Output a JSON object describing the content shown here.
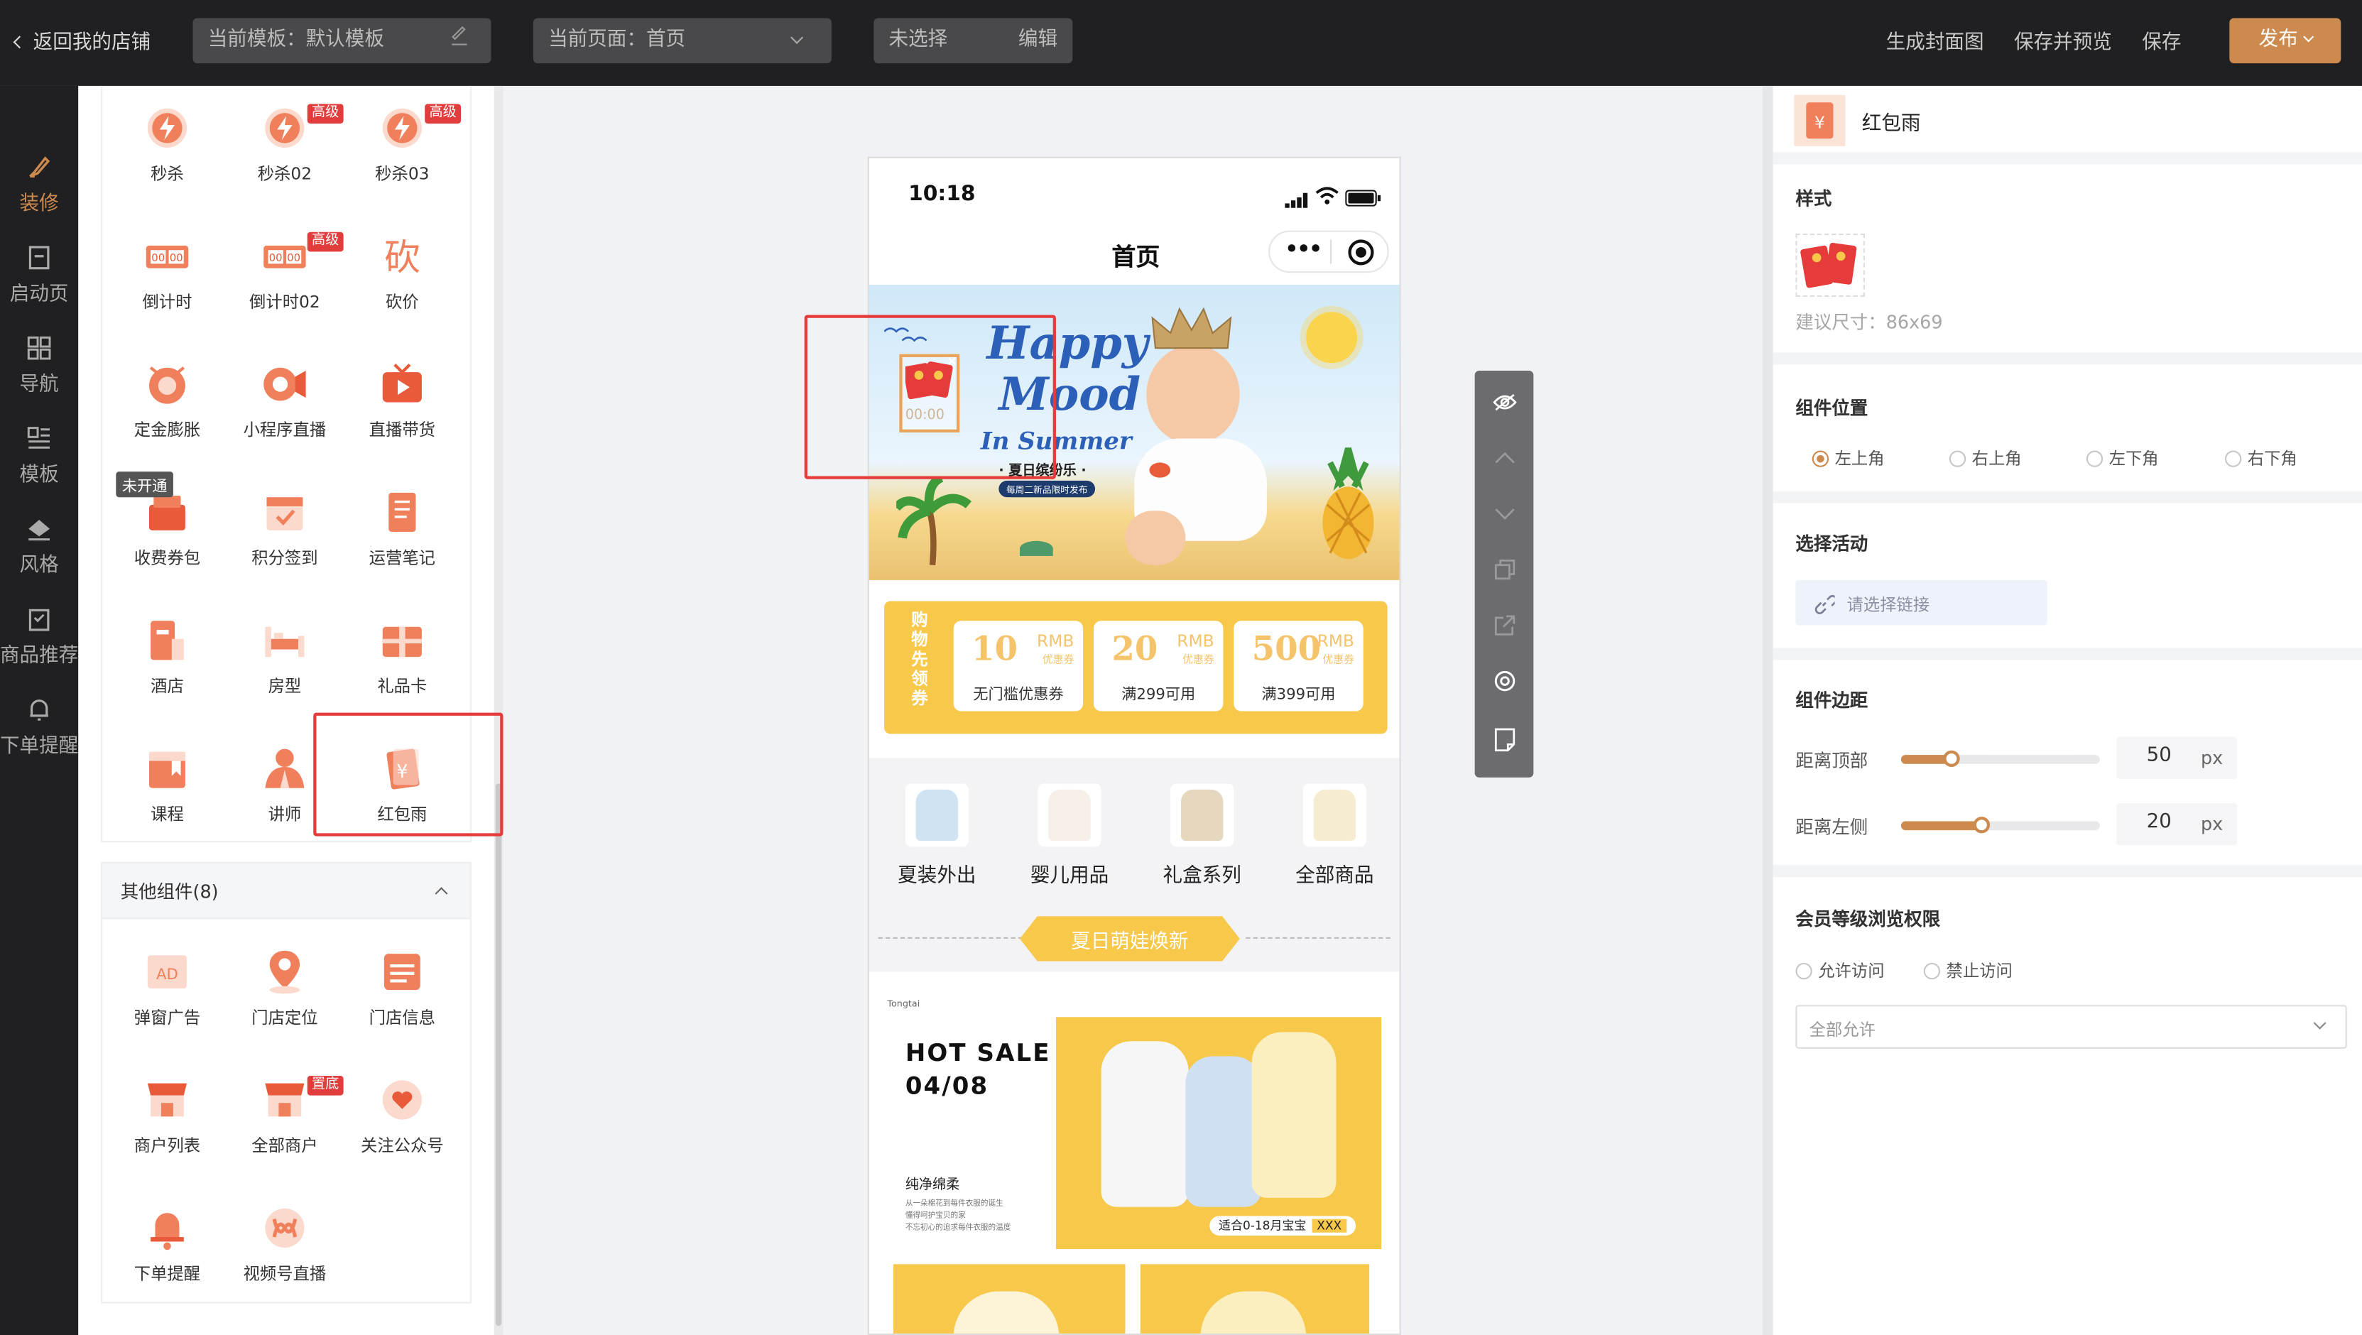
{
  "topbar": {
    "back_label": "返回我的店铺",
    "template_field": "当前模板：默认模板",
    "page_field": "当前页面：首页",
    "unselected_field": "未选择",
    "edit_label": "编辑",
    "generate_cover": "生成封面图",
    "save_preview": "保存并预览",
    "save": "保存",
    "publish": "发布"
  },
  "leftnav": {
    "items": [
      {
        "label": "装修",
        "icon": "brush-icon",
        "active": true
      },
      {
        "label": "启动页",
        "icon": "document-icon"
      },
      {
        "label": "导航",
        "icon": "grid-icon"
      },
      {
        "label": "模板",
        "icon": "template-icon"
      },
      {
        "label": "风格",
        "icon": "paint-bucket-icon"
      },
      {
        "label": "商品推荐",
        "icon": "product-icon"
      },
      {
        "label": "下单提醒",
        "icon": "bell-icon"
      }
    ]
  },
  "components": {
    "marketing": [
      {
        "label": "秒杀",
        "icon": "flash-sale-icon"
      },
      {
        "label": "秒杀02",
        "icon": "flash-sale-icon",
        "badge": "高级"
      },
      {
        "label": "秒杀03",
        "icon": "flash-sale-icon",
        "badge": "高级"
      },
      {
        "label": "倒计时",
        "icon": "countdown-icon"
      },
      {
        "label": "倒计时02",
        "icon": "countdown-icon",
        "badge": "高级"
      },
      {
        "label": "砍价",
        "icon": "bargain-icon"
      },
      {
        "label": "定金膨胀",
        "icon": "deposit-icon"
      },
      {
        "label": "小程序直播",
        "icon": "live-camera-icon"
      },
      {
        "label": "直播带货",
        "icon": "live-tv-icon"
      },
      {
        "label": "收费券包",
        "icon": "coupon-pack-icon",
        "tag": "未开通"
      },
      {
        "label": "积分签到",
        "icon": "calendar-check-icon"
      },
      {
        "label": "运营笔记",
        "icon": "notebook-icon"
      },
      {
        "label": "酒店",
        "icon": "hotel-icon"
      },
      {
        "label": "房型",
        "icon": "bed-icon"
      },
      {
        "label": "礼品卡",
        "icon": "gift-card-icon"
      },
      {
        "label": "课程",
        "icon": "course-icon"
      },
      {
        "label": "讲师",
        "icon": "lecturer-icon"
      },
      {
        "label": "红包雨",
        "icon": "red-envelope-icon"
      }
    ],
    "others_header": "其他组件(8)",
    "others": [
      {
        "label": "弹窗广告",
        "icon": "ad-icon"
      },
      {
        "label": "门店定位",
        "icon": "location-pin-icon"
      },
      {
        "label": "门店信息",
        "icon": "store-info-icon"
      },
      {
        "label": "商户列表",
        "icon": "shop-icon"
      },
      {
        "label": "全部商户",
        "icon": "shop-icon",
        "badge": "置底"
      },
      {
        "label": "关注公众号",
        "icon": "heart-icon"
      },
      {
        "label": "下单提醒",
        "icon": "bell-icon"
      },
      {
        "label": "视频号直播",
        "icon": "video-channel-icon"
      }
    ]
  },
  "phone": {
    "time": "10:18",
    "title": "首页",
    "banner": {
      "line1": "Happy",
      "line2": "Mood",
      "line3": "In Summer",
      "subtitle": "· 夏日缤纷乐 ·",
      "small": "每周二新品限时发布",
      "countdown": "00:00"
    },
    "coupon_label": "购物先领券",
    "coupons": [
      {
        "amount": "10",
        "unit": "RMB",
        "type": "优惠券",
        "desc": "无门槛优惠券"
      },
      {
        "amount": "20",
        "unit": "RMB",
        "type": "优惠券",
        "desc": "满299可用"
      },
      {
        "amount": "500",
        "unit": "RMB",
        "type": "优惠券",
        "desc": "满399可用"
      }
    ],
    "categories": [
      {
        "label": "夏装外出"
      },
      {
        "label": "婴儿用品"
      },
      {
        "label": "礼盒系列"
      },
      {
        "label": "全部商品"
      }
    ],
    "section_title": "夏日萌娃焕新",
    "hot": {
      "brand": "Tongtai",
      "title": "HOT SALE",
      "date": "04/08",
      "product": "纯净绵柔",
      "desc1": "从一朵棉花到每件衣服的诞生",
      "desc2": "懂得呵护宝贝的家",
      "desc3": "不忘初心的追求每件衣服的温度",
      "tag": "适合0-18月宝宝",
      "tag_price": "XXX"
    }
  },
  "toolbar": {
    "icons": [
      "eye-hide-icon",
      "arrow-up-icon",
      "arrow-down-icon",
      "copy-icon",
      "share-icon",
      "settings-icon",
      "note-icon"
    ]
  },
  "rightpanel": {
    "component_name": "红包雨",
    "style_title": "样式",
    "size_hint": "建议尺寸：86x69",
    "position_title": "组件位置",
    "positions": [
      "左上角",
      "右上角",
      "左下角",
      "右下角"
    ],
    "position_selected": "左上角",
    "activity_title": "选择活动",
    "activity_placeholder": "请选择链接",
    "margin_title": "组件边距",
    "margin_top_label": "距离顶部",
    "margin_top_value": "50",
    "margin_left_label": "距离左侧",
    "margin_left_value": "20",
    "unit": "px",
    "margin_top_ratio": 0.25,
    "margin_left_ratio": 0.4,
    "access_title": "会员等级浏览权限",
    "access_options": [
      "允许访问",
      "禁止访问"
    ],
    "access_select": "全部允许"
  },
  "colors": {
    "accent": "#cd8a4e",
    "topbar": "#202022",
    "highlight": "#e63b3b",
    "coupon_yellow": "#f7c84a"
  }
}
